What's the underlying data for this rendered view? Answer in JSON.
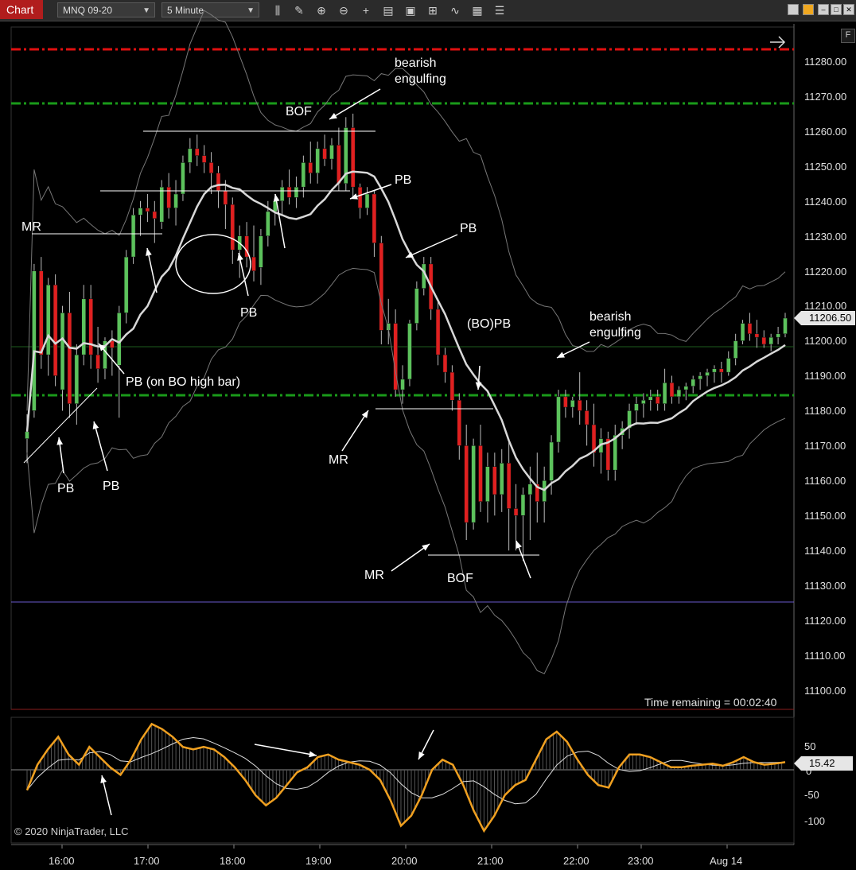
{
  "toolbar": {
    "tab_label": "Chart",
    "instrument": "MNQ 09-20",
    "interval": "5 Minute"
  },
  "price_axis": {
    "labels": [
      "11280.00",
      "11270.00",
      "11260.00",
      "11250.00",
      "11240.00",
      "11230.00",
      "11220.00",
      "11210.00",
      "11200.00",
      "11190.00",
      "11180.00",
      "11170.00",
      "11160.00",
      "11150.00",
      "11140.00",
      "11130.00",
      "11120.00",
      "11110.00",
      "11100.00"
    ],
    "last_price": "11206.50"
  },
  "indicator_axis": {
    "labels": [
      "50",
      "0",
      "-50",
      "-100"
    ],
    "last_value": "15.42"
  },
  "time_axis": [
    "16:00",
    "17:00",
    "18:00",
    "19:00",
    "20:00",
    "21:00",
    "22:00",
    "23:00",
    "Aug 14"
  ],
  "annotations": {
    "mr_top_left": "MR",
    "bearish_engulfing_1a": "bearish",
    "bearish_engulfing_1b": "engulfing",
    "bof_top": "BOF",
    "pb_1": "PB",
    "pb_2": "PB",
    "pb_circle": "PB",
    "pb_bo_high": "PB (on BO high bar)",
    "pb_left_1": "PB",
    "pb_left_2": "PB",
    "mr_mid": "MR",
    "bo_pb": "(BO)PB",
    "bearish_engulfing_2a": "bearish",
    "bearish_engulfing_2b": "engulfing",
    "mr_bottom": "MR",
    "bof_bottom": "BOF"
  },
  "status": {
    "time_remaining": "Time remaining = 00:02:40",
    "copyright": "© 2020 NinjaTrader, LLC"
  },
  "colors": {
    "bull": "#5cc25c",
    "bear": "#e02020",
    "red_line": "#e01010",
    "green_line": "#1a9a1a",
    "indicator": "#f0a020"
  },
  "chart_data": {
    "type": "candlestick",
    "ylim": [
      11095,
      11288
    ],
    "candles": [
      [
        11172,
        11179,
        11165,
        11174
      ],
      [
        11180,
        11222,
        11178,
        11220
      ],
      [
        11220,
        11224,
        11192,
        11196
      ],
      [
        11196,
        11218,
        11190,
        11216
      ],
      [
        11216,
        11219,
        11187,
        11190
      ],
      [
        11186,
        11210,
        11180,
        11208
      ],
      [
        11208,
        11214,
        11178,
        11182
      ],
      [
        11182,
        11199,
        11176,
        11196
      ],
      [
        11196,
        11216,
        11193,
        11212
      ],
      [
        11212,
        11216,
        11192,
        11196
      ],
      [
        11196,
        11204,
        11188,
        11192
      ],
      [
        11192,
        11201,
        11189,
        11200
      ],
      [
        11200,
        11203,
        11190,
        11198
      ],
      [
        11193,
        11210,
        11178,
        11208
      ],
      [
        11208,
        11226,
        11205,
        11224
      ],
      [
        11224,
        11238,
        11222,
        11236
      ],
      [
        11236,
        11240,
        11230,
        11238
      ],
      [
        11238,
        11242,
        11234,
        11237
      ],
      [
        11237,
        11240,
        11228,
        11235
      ],
      [
        11234,
        11246,
        11232,
        11244
      ],
      [
        11244,
        11248,
        11235,
        11238
      ],
      [
        11238,
        11246,
        11233,
        11242
      ],
      [
        11242,
        11253,
        11240,
        11251
      ],
      [
        11251,
        11258,
        11248,
        11255
      ],
      [
        11255,
        11259,
        11250,
        11253
      ],
      [
        11253,
        11256,
        11248,
        11251
      ],
      [
        11251,
        11254,
        11242,
        11248
      ],
      [
        11248,
        11250,
        11238,
        11243
      ],
      [
        11243,
        11246,
        11232,
        11239
      ],
      [
        11239,
        11241,
        11222,
        11226
      ],
      [
        11226,
        11233,
        11218,
        11230
      ],
      [
        11230,
        11234,
        11221,
        11224
      ],
      [
        11224,
        11233,
        11217,
        11220
      ],
      [
        11221,
        11232,
        11216,
        11230
      ],
      [
        11230,
        11240,
        11227,
        11237
      ],
      [
        11237,
        11242,
        11233,
        11240
      ],
      [
        11240,
        11246,
        11236,
        11244
      ],
      [
        11244,
        11249,
        11239,
        11241
      ],
      [
        11241,
        11247,
        11238,
        11244
      ],
      [
        11244,
        11253,
        11241,
        11251
      ],
      [
        11251,
        11257,
        11245,
        11248
      ],
      [
        11248,
        11257,
        11245,
        11255
      ],
      [
        11255,
        11259,
        11250,
        11252
      ],
      [
        11252,
        11258,
        11249,
        11256
      ],
      [
        11256,
        11261,
        11243,
        11245
      ],
      [
        11245,
        11264,
        11243,
        11261
      ],
      [
        11261,
        11265,
        11241,
        11244
      ],
      [
        11244,
        11245,
        11235,
        11238
      ],
      [
        11238,
        11244,
        11236,
        11242
      ],
      [
        11242,
        11243,
        11224,
        11228
      ],
      [
        11228,
        11230,
        11199,
        11203
      ],
      [
        11203,
        11212,
        11199,
        11205
      ],
      [
        11205,
        11209,
        11184,
        11186
      ],
      [
        11186,
        11193,
        11182,
        11189
      ],
      [
        11189,
        11206,
        11187,
        11205
      ],
      [
        11205,
        11217,
        11203,
        11215
      ],
      [
        11215,
        11224,
        11213,
        11222
      ],
      [
        11222,
        11224,
        11206,
        11209
      ],
      [
        11209,
        11212,
        11193,
        11196
      ],
      [
        11196,
        11198,
        11188,
        11191
      ],
      [
        11191,
        11193,
        11180,
        11183
      ],
      [
        11183,
        11185,
        11166,
        11170
      ],
      [
        11170,
        11176,
        11143,
        11148
      ],
      [
        11148,
        11172,
        11146,
        11170
      ],
      [
        11170,
        11176,
        11151,
        11154
      ],
      [
        11154,
        11168,
        11148,
        11164
      ],
      [
        11164,
        11168,
        11150,
        11156
      ],
      [
        11156,
        11169,
        11151,
        11165
      ],
      [
        11165,
        11172,
        11140,
        11152
      ],
      [
        11152,
        11159,
        11140,
        11150
      ],
      [
        11150,
        11158,
        11137,
        11156
      ],
      [
        11156,
        11164,
        11143,
        11159
      ],
      [
        11159,
        11168,
        11148,
        11154
      ],
      [
        11154,
        11164,
        11148,
        11160
      ],
      [
        11160,
        11173,
        11156,
        11171
      ],
      [
        11171,
        11186,
        11168,
        11184
      ],
      [
        11184,
        11186,
        11178,
        11181
      ],
      [
        11181,
        11184,
        11178,
        11183
      ],
      [
        11183,
        11191,
        11176,
        11180
      ],
      [
        11180,
        11183,
        11170,
        11176
      ],
      [
        11176,
        11182,
        11164,
        11168
      ],
      [
        11168,
        11175,
        11162,
        11172
      ],
      [
        11172,
        11174,
        11160,
        11163
      ],
      [
        11163,
        11176,
        11160,
        11173
      ],
      [
        11173,
        11177,
        11169,
        11175
      ],
      [
        11175,
        11182,
        11172,
        11180
      ],
      [
        11180,
        11184,
        11176,
        11182
      ],
      [
        11182,
        11185,
        11178,
        11183
      ],
      [
        11183,
        11186,
        11180,
        11184
      ],
      [
        11184,
        11186,
        11180,
        11182
      ],
      [
        11182,
        11192,
        11180,
        11188
      ],
      [
        11188,
        11190,
        11182,
        11184
      ],
      [
        11184,
        11187,
        11182,
        11186
      ],
      [
        11186,
        11188,
        11183,
        11187
      ],
      [
        11187,
        11190,
        11185,
        11189
      ],
      [
        11189,
        11191,
        11186,
        11190
      ],
      [
        11190,
        11192,
        11187,
        11191
      ],
      [
        11191,
        11193,
        11188,
        11192
      ],
      [
        11192,
        11194,
        11188,
        11191
      ],
      [
        11191,
        11197,
        11190,
        11195
      ],
      [
        11195,
        11202,
        11193,
        11200
      ],
      [
        11200,
        11206,
        11199,
        11205
      ],
      [
        11205,
        11208,
        11200,
        11202
      ],
      [
        11202,
        11206,
        11198,
        11201
      ],
      [
        11201,
        11203,
        11198,
        11199
      ],
      [
        11199,
        11202,
        11197,
        11201
      ],
      [
        11201,
        11204,
        11199,
        11202
      ],
      [
        11202,
        11208,
        11201,
        11206.5
      ]
    ],
    "indicator": {
      "values": [
        -40,
        10,
        40,
        65,
        30,
        10,
        45,
        25,
        5,
        -10,
        20,
        60,
        90,
        80,
        65,
        45,
        40,
        45,
        40,
        25,
        5,
        -20,
        -50,
        -70,
        -55,
        -30,
        -5,
        5,
        25,
        30,
        20,
        15,
        10,
        0,
        -20,
        -60,
        -110,
        -90,
        -50,
        0,
        20,
        10,
        -30,
        -80,
        -120,
        -90,
        -50,
        -30,
        -20,
        20,
        60,
        75,
        55,
        20,
        -10,
        -30,
        -35,
        5,
        30,
        30,
        25,
        15,
        5,
        5,
        8,
        10,
        12,
        8,
        15,
        25,
        15,
        10,
        12,
        15
      ]
    }
  }
}
